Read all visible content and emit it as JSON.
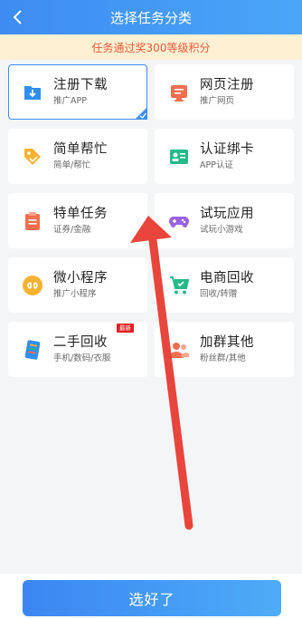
{
  "header": {
    "title": "选择任务分类"
  },
  "notice": {
    "text": "任务通过奖300等级积分"
  },
  "categories": [
    {
      "name": "注册下载",
      "sub": "推广APP",
      "icon": "download-icon",
      "color": "#2f8ff0",
      "selected": true
    },
    {
      "name": "网页注册",
      "sub": "推广网页",
      "icon": "webpage-icon",
      "color": "#f46e4e"
    },
    {
      "name": "简单帮忙",
      "sub": "简单/帮忙",
      "icon": "tag-icon",
      "color": "#f7b230"
    },
    {
      "name": "认证绑卡",
      "sub": "APP认证",
      "icon": "id-card-icon",
      "color": "#26b98a"
    },
    {
      "name": "特单任务",
      "sub": "证券/金融",
      "icon": "clipboard-icon",
      "color": "#f46e4e"
    },
    {
      "name": "试玩应用",
      "sub": "试玩小游戏",
      "icon": "gamepad-icon",
      "color": "#9a62e0"
    },
    {
      "name": "微小程序",
      "sub": "推广小程序",
      "icon": "mini-program-icon",
      "color": "#f7b230"
    },
    {
      "name": "电商回收",
      "sub": "回收/转赠",
      "icon": "cart-icon",
      "color": "#26b98a"
    },
    {
      "name": "二手回收",
      "sub": "手机/数码/衣服",
      "icon": "phone-icon",
      "color": "#2f8ff0",
      "badge": "最新"
    },
    {
      "name": "加群其他",
      "sub": "粉丝群/其他",
      "icon": "group-icon",
      "color": "#f46e4e"
    }
  ],
  "footer": {
    "button_label": "选好了"
  },
  "colors": {
    "accent": "#3c8ef3",
    "notice_bg": "#fdf0d3",
    "notice_text": "#e85a3a",
    "annotation_arrow": "#e8453c"
  }
}
